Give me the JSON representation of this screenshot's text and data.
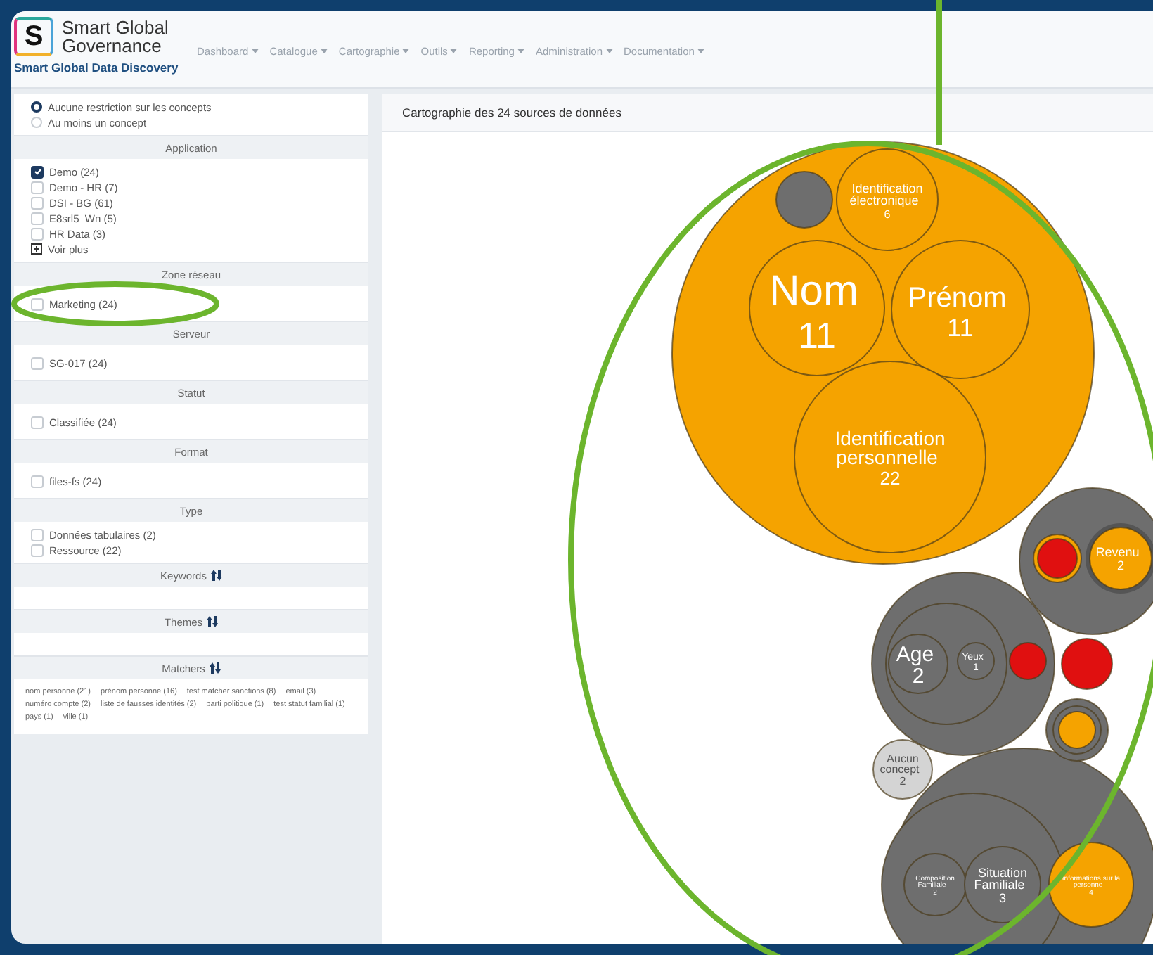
{
  "header": {
    "logo_letter": "S",
    "title": "Smart Global Governance",
    "subtitle": "Smart Global Data Discovery",
    "nav": [
      "Dashboard",
      "Catalogue",
      "Cartographie",
      "Outils",
      "Reporting",
      "Administration",
      "Documentation"
    ]
  },
  "concept_filter": [
    {
      "label": "Aucune restriction sur les concepts",
      "selected": true
    },
    {
      "label": "Au moins un concept",
      "selected": false
    }
  ],
  "sections": [
    {
      "title": "Application",
      "kind": "checklist",
      "sortable": false,
      "more": "Voir plus",
      "items": [
        {
          "label": "Demo (24)",
          "checked": true
        },
        {
          "label": "Demo - HR (7)",
          "checked": false
        },
        {
          "label": "DSI - BG (61)",
          "checked": false
        },
        {
          "label": "E8srl5_Wn (5)",
          "checked": false
        },
        {
          "label": "HR Data (3)",
          "checked": false
        }
      ]
    },
    {
      "title": "Zone réseau",
      "kind": "checklist",
      "sortable": false,
      "items": [
        {
          "label": "Marketing (24)",
          "checked": false
        }
      ]
    },
    {
      "title": "Serveur",
      "kind": "checklist",
      "sortable": false,
      "items": [
        {
          "label": "SG-017 (24)",
          "checked": false
        }
      ]
    },
    {
      "title": "Statut",
      "kind": "checklist",
      "sortable": false,
      "items": [
        {
          "label": "Classifiée (24)",
          "checked": false
        }
      ]
    },
    {
      "title": "Format",
      "kind": "checklist",
      "sortable": false,
      "items": [
        {
          "label": "files-fs (24)",
          "checked": false
        }
      ]
    },
    {
      "title": "Type",
      "kind": "checklist",
      "sortable": false,
      "items": [
        {
          "label": "Données tabulaires (2)",
          "checked": false
        },
        {
          "label": "Ressource (22)",
          "checked": false
        }
      ]
    },
    {
      "title": "Keywords",
      "kind": "empty",
      "sortable": true
    },
    {
      "title": "Themes",
      "kind": "empty",
      "sortable": true
    },
    {
      "title": "Matchers",
      "kind": "tags",
      "sortable": true,
      "items": [
        {
          "label": "nom personne (21)"
        },
        {
          "label": "prénom personne (16)"
        },
        {
          "label": "test matcher sanctions (8)"
        },
        {
          "label": "email (3)"
        },
        {
          "label": "numéro compte (2)"
        },
        {
          "label": "liste de fausses identités (2)"
        },
        {
          "label": "parti politique (1)"
        },
        {
          "label": "test statut familial (1)"
        },
        {
          "label": "pays (1)"
        },
        {
          "label": "ville (1)"
        }
      ]
    }
  ],
  "chart_panel": {
    "title": "Cartographie des 24 sources de données",
    "bubbles": [
      {
        "label": "Identification électronique",
        "count": "6",
        "color": "#f5a300"
      },
      {
        "label": "Nom",
        "count": "11",
        "color": "#f5a300"
      },
      {
        "label": "Prénom",
        "count": "11",
        "color": "#f5a300"
      },
      {
        "label": "Identification personnelle",
        "count": "22",
        "color": "#f5a300"
      },
      {
        "label": "Revenu",
        "count": "2",
        "color": "#f5a300"
      },
      {
        "label": "Age",
        "count": "2",
        "color": "#6e6e6e"
      },
      {
        "label": "Yeux",
        "count": "1",
        "color": "#6e6e6e"
      },
      {
        "label": "Aucun concept",
        "count": "2",
        "color": "#d4d4d4"
      },
      {
        "label": "Composition Familiale",
        "count": "2",
        "color": "#6e6e6e"
      },
      {
        "label": "Situation Familiale",
        "count": "3",
        "color": "#6e6e6e"
      },
      {
        "label": "Informations sur la personne",
        "count": "4",
        "color": "#f5a300"
      }
    ]
  }
}
